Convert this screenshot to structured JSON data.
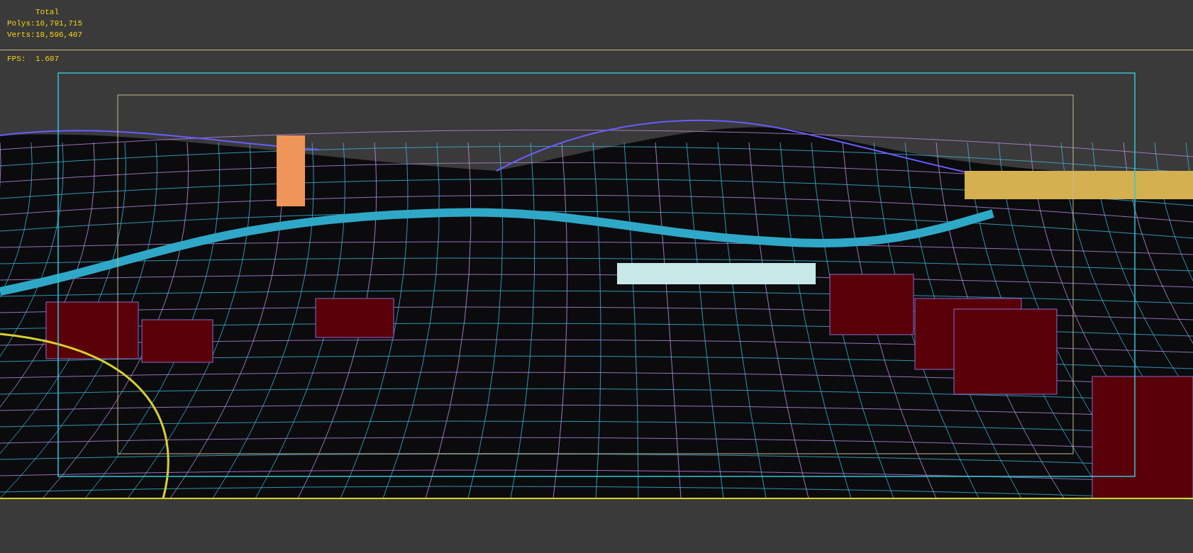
{
  "stats": {
    "heading": "Total",
    "rows": [
      {
        "label": "Polys:",
        "value": "16,791,715"
      },
      {
        "label": "Verts:",
        "value": "18,596,407"
      }
    ]
  },
  "fps": {
    "label": "FPS:",
    "value": "1.607"
  }
}
